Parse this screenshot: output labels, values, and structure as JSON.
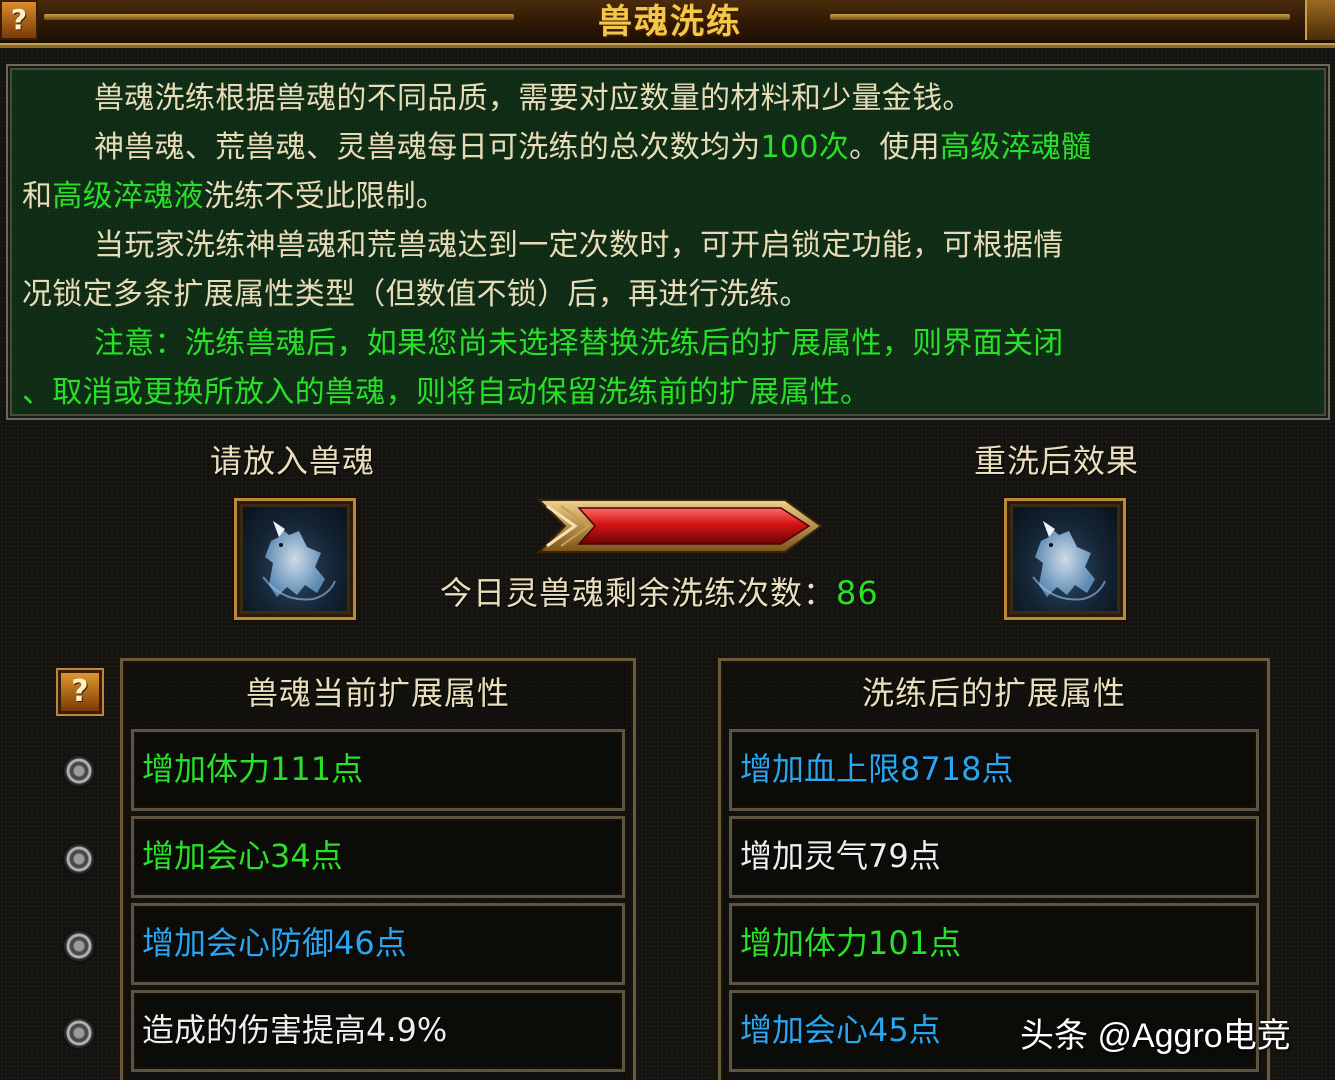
{
  "window": {
    "title": "兽魂洗练",
    "help": "?"
  },
  "info": {
    "line1": "兽魂洗练根据兽魂的不同品质，需要对应数量的材料和少量金钱。",
    "line2a": "神兽魂、荒兽魂、灵兽魂每日可洗练的总次数均为",
    "line2_count": "100次",
    "line2b": "。使用",
    "line2_item1": "高级淬魂髓",
    "line3a": "和",
    "line3_item2": "高级淬魂液",
    "line3b": "洗练不受此限制。",
    "line4": "当玩家洗练神兽魂和荒兽魂达到一定次数时，可开启锁定功能，可根据情",
    "line5": "况锁定多条扩展属性类型（但数值不锁）后，再进行洗练。",
    "line6": "注意：洗练兽魂后，如果您尚未选择替换洗练后的扩展属性，则界面关闭",
    "line7": "、取消或更换所放入的兽魂，则将自动保留洗练前的扩展属性。"
  },
  "slots": {
    "left_label": "请放入兽魂",
    "right_label": "重洗后效果"
  },
  "remaining": {
    "label": "今日灵兽魂剩余洗练次数：",
    "value": "86"
  },
  "current_attrs": {
    "header": "兽魂当前扩展属性",
    "help": "?",
    "rows": [
      {
        "text": "增加体力111点",
        "color": "green"
      },
      {
        "text": "增加会心34点",
        "color": "green"
      },
      {
        "text": "增加会心防御46点",
        "color": "blue"
      },
      {
        "text": "造成的伤害提高4.9%",
        "color": "white"
      }
    ]
  },
  "new_attrs": {
    "header": "洗练后的扩展属性",
    "rows": [
      {
        "text": "增加血上限8718点",
        "color": "blue"
      },
      {
        "text": "增加灵气79点",
        "color": "white"
      },
      {
        "text": "增加体力101点",
        "color": "green"
      },
      {
        "text": "增加会心45点",
        "color": "blue"
      }
    ]
  },
  "watermark": "头条 @Aggro电竞",
  "colors": {
    "green": "#28e028",
    "blue": "#2aa6f0",
    "white": "#eeeeee",
    "gold": "#f2c84a"
  }
}
